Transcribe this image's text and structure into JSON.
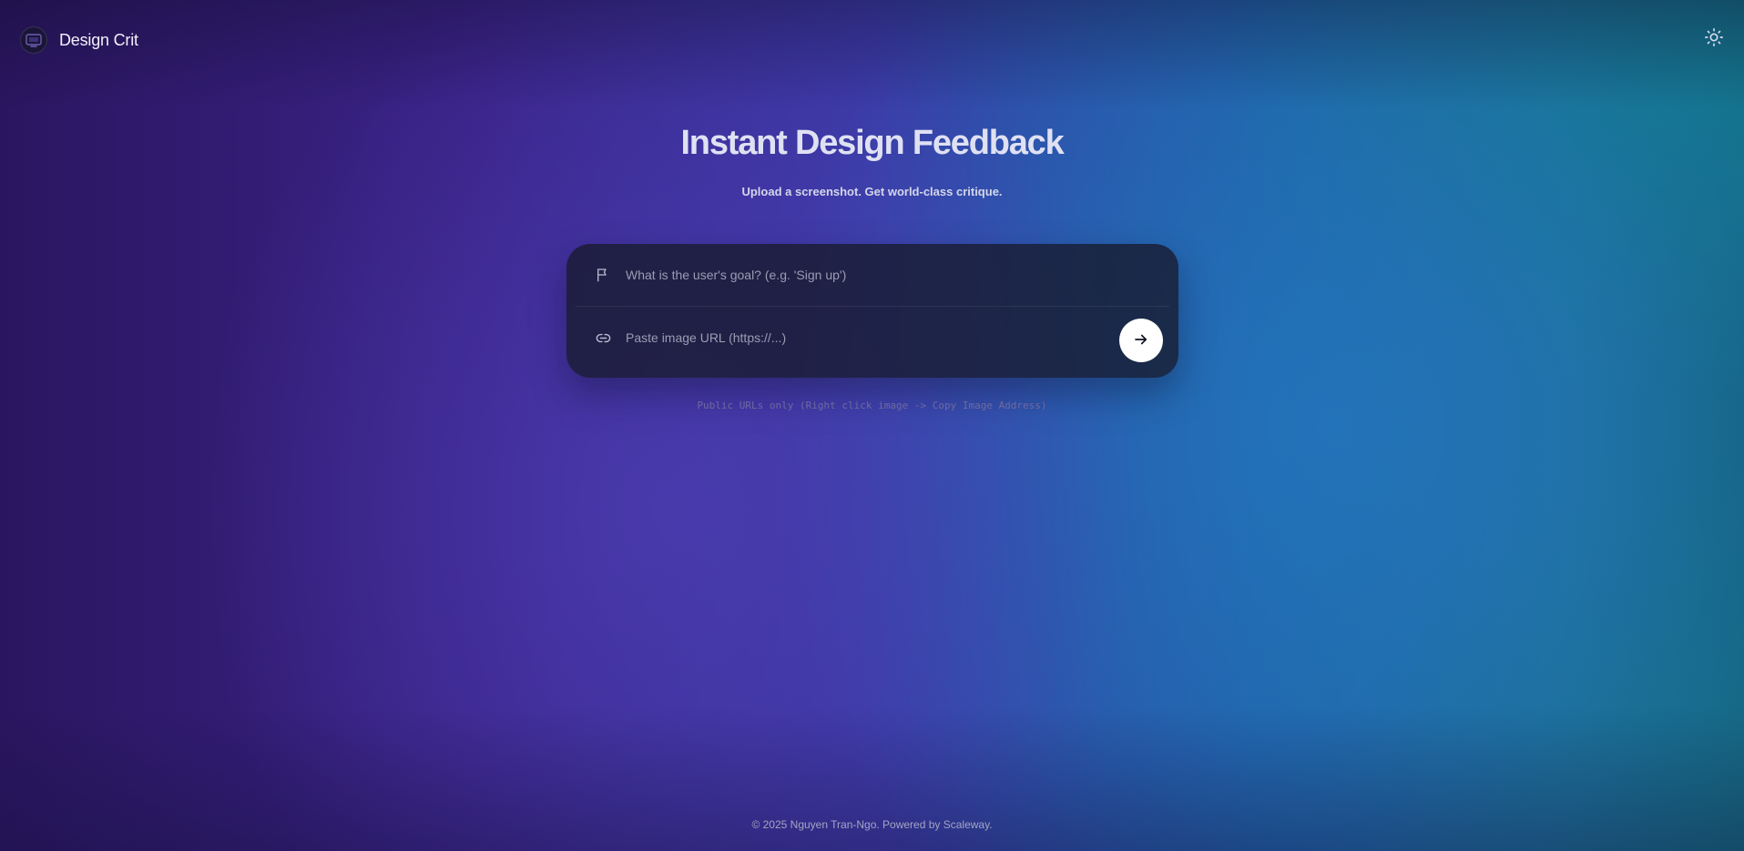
{
  "header": {
    "brand": "Design Crit",
    "logo_icon": "logo-icon",
    "theme_toggle_icon": "sun-icon"
  },
  "hero": {
    "title": "Instant Design Feedback",
    "subtitle": "Upload a screenshot. Get world-class critique."
  },
  "form": {
    "goal": {
      "icon": "flag-icon",
      "value": "",
      "placeholder": "What is the user's goal? (e.g. 'Sign up')"
    },
    "url": {
      "icon": "link-icon",
      "value": "",
      "placeholder": "Paste image URL (https://...)"
    },
    "submit_icon": "arrow-right-icon"
  },
  "hint": "Public URLs only (Right click image -> Copy Image Address)",
  "footer": "© 2025 Nguyen Tran-Ngo. Powered by Scaleway.",
  "colors": {
    "background_left": "#2a1660",
    "background_center": "#3a3aa6",
    "background_right": "#1f5fa6",
    "card": "#181a2e",
    "submit_button": "#ffffff",
    "title_text": "#dfe1f3"
  }
}
